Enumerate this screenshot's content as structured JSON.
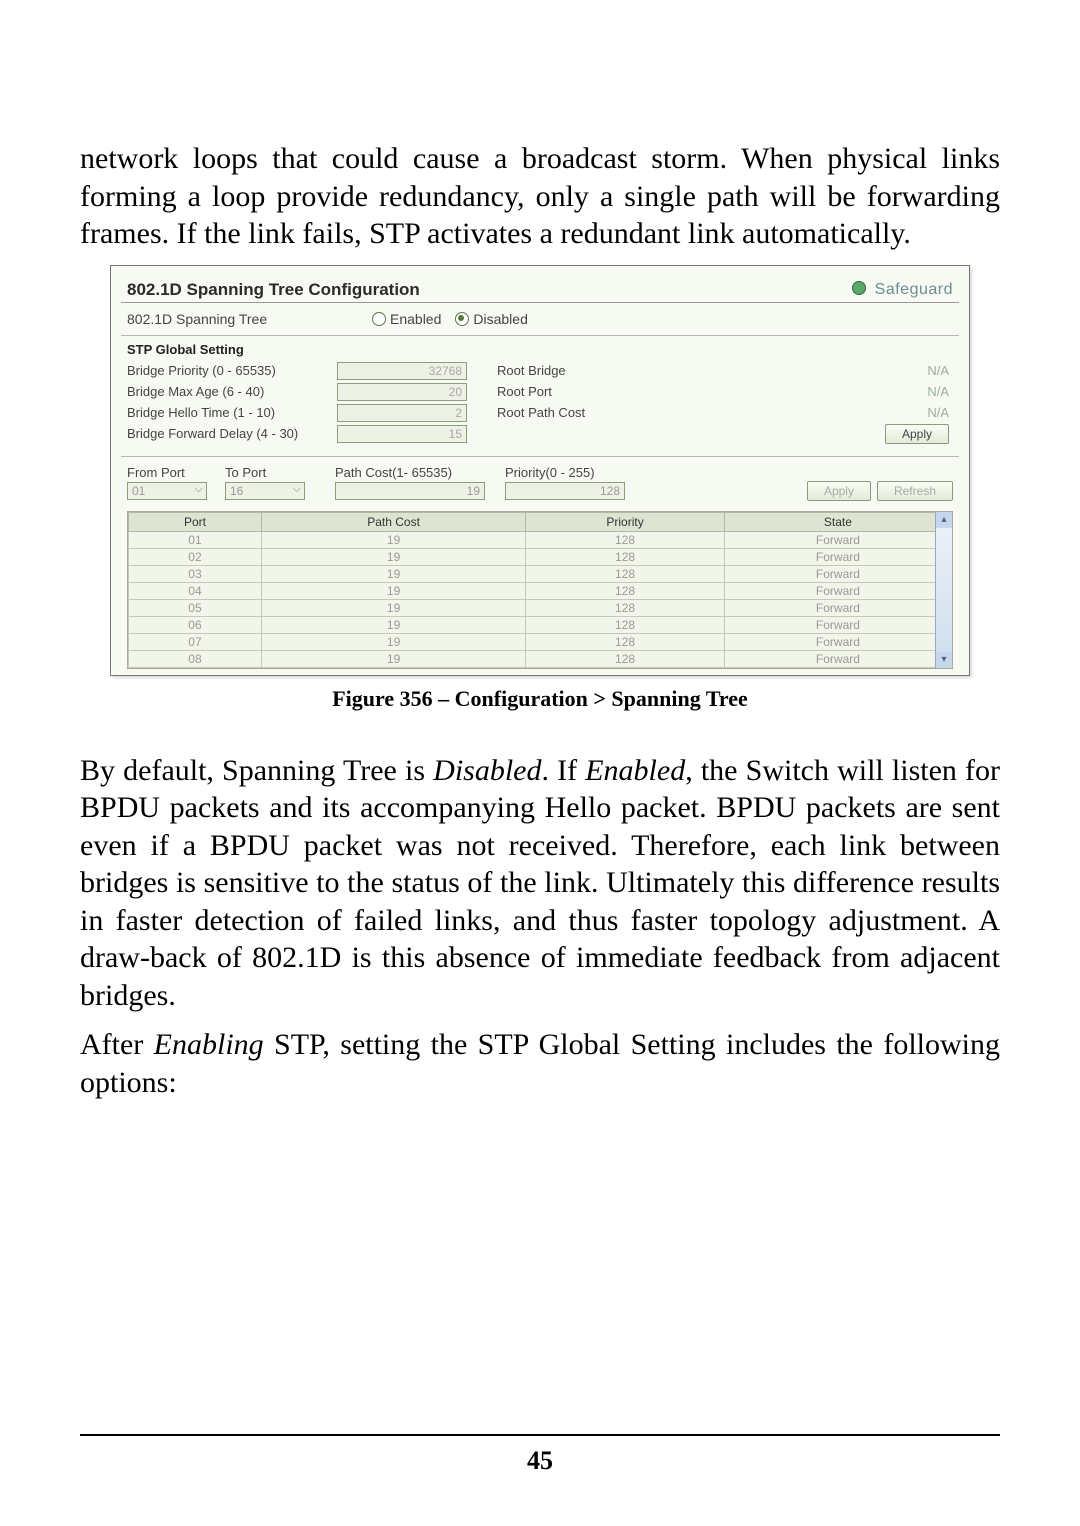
{
  "intro_paragraph": "network loops that could cause a broadcast storm. When physical links forming a loop provide redundancy, only a single path will be forwarding frames. If the link fails, STP activates a redundant link automatically.",
  "figure": {
    "title": "802.1D Spanning Tree Configuration",
    "safeguard": "Safeguard",
    "toggle": {
      "label": "802.1D Spanning Tree",
      "enabled": "Enabled",
      "disabled": "Disabled"
    },
    "global_title": "STP Global Setting",
    "settings": [
      {
        "label": "Bridge Priority (0 - 65535)",
        "value": "32768",
        "rlabel": "Root Bridge",
        "rval": "N/A"
      },
      {
        "label": "Bridge Max Age (6 - 40)",
        "value": "20",
        "rlabel": "Root Port",
        "rval": "N/A"
      },
      {
        "label": "Bridge Hello Time (1 - 10)",
        "value": "2",
        "rlabel": "Root Path Cost",
        "rval": "N/A"
      },
      {
        "label": "Bridge Forward  Delay (4 - 30)",
        "value": "15",
        "rlabel": "",
        "rval": ""
      }
    ],
    "apply_btn": "Apply",
    "range": {
      "from_label": "From Port",
      "from_value": "01",
      "to_label": "To Port",
      "to_value": "16",
      "pathcost_label": "Path Cost(1- 65535)",
      "pathcost_value": "19",
      "priority_label": "Priority(0 - 255)",
      "priority_value": "128",
      "apply": "Apply",
      "refresh": "Refresh"
    },
    "table_headers": [
      "Port",
      "Path Cost",
      "Priority",
      "State"
    ],
    "table_rows": [
      {
        "port": "01",
        "path": "19",
        "prio": "128",
        "state": "Forward"
      },
      {
        "port": "02",
        "path": "19",
        "prio": "128",
        "state": "Forward"
      },
      {
        "port": "03",
        "path": "19",
        "prio": "128",
        "state": "Forward"
      },
      {
        "port": "04",
        "path": "19",
        "prio": "128",
        "state": "Forward"
      },
      {
        "port": "05",
        "path": "19",
        "prio": "128",
        "state": "Forward"
      },
      {
        "port": "06",
        "path": "19",
        "prio": "128",
        "state": "Forward"
      },
      {
        "port": "07",
        "path": "19",
        "prio": "128",
        "state": "Forward"
      },
      {
        "port": "08",
        "path": "19",
        "prio": "128",
        "state": "Forward"
      }
    ]
  },
  "caption": "Figure 356 – Configuration > Spanning Tree",
  "para2_pre": "By default, Spanning Tree is ",
  "para2_it1": "Disabled",
  "para2_mid1": ". If ",
  "para2_it2": "Enabled",
  "para2_post": ", the Switch will listen for BPDU packets and its accompanying Hello packet. BPDU packets are sent even if a BPDU packet was not received. Therefore, each link between bridges is sensitive to the status of the link. Ultimately this difference results in faster detection of failed links, and thus faster topology adjustment. A draw-back of 802.1D is this absence of immediate feedback from adjacent bridges.",
  "para3_pre": "After ",
  "para3_it": "Enabling",
  "para3_post": " STP, setting the STP Global Setting includes the following options:",
  "page_number": "45"
}
